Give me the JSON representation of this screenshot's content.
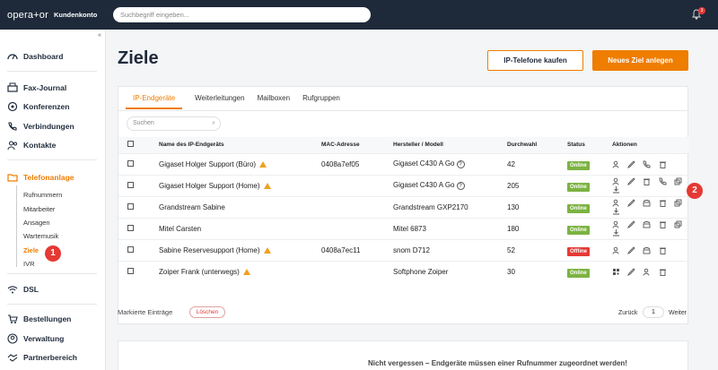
{
  "app": {
    "logo": "opera+or",
    "logo_sub": "Kundenkonto",
    "search_placeholder": "Suchbegriff eingeben...",
    "notification_count": "3"
  },
  "sidebar": {
    "items": [
      {
        "label": "Dashboard",
        "icon": "gauge-icon"
      },
      {
        "label": "Fax-Journal",
        "icon": "fax-icon"
      },
      {
        "label": "Konferenzen",
        "icon": "conference-icon"
      },
      {
        "label": "Verbindungen",
        "icon": "phone-icon"
      },
      {
        "label": "Kontakte",
        "icon": "contacts-icon"
      },
      {
        "label": "Telefonanlage",
        "icon": "folder-icon"
      },
      {
        "label": "DSL",
        "icon": "wifi-icon"
      },
      {
        "label": "Bestellungen",
        "icon": "cart-icon"
      },
      {
        "label": "Verwaltung",
        "icon": "user-circle-icon"
      },
      {
        "label": "Partnerbereich",
        "icon": "handshake-icon"
      }
    ],
    "sub_items": [
      "Rufnummern",
      "Mitarbeiter",
      "Ansagen",
      "Wartemusik",
      "Ziele",
      "IVR"
    ],
    "marker_1": "1"
  },
  "main": {
    "title": "Ziele",
    "btn_buy": "IP-Telefone kaufen",
    "btn_new": "Neues Ziel anlegen",
    "tabs": [
      "IP-Endgeräte",
      "Weiterleitungen",
      "Mailboxen",
      "Rufgruppen"
    ],
    "search_placeholder": "Suchen",
    "columns": [
      "Name des IP-Endgeräts",
      "MAC-Adresse",
      "Hersteller / Modell",
      "Durchwahl",
      "Status",
      "Aktionen"
    ],
    "rows": [
      {
        "name": "Gigaset Holger Support (Büro)",
        "mac": "0408a7ef05",
        "model": "Gigaset C430 A Go",
        "ext": "42",
        "status": "Online"
      },
      {
        "name": "Gigaset Holger Support (Home)",
        "mac": "",
        "model": "Gigaset C430 A Go",
        "ext": "205",
        "status": "Online"
      },
      {
        "name": "Grandstream Sabine",
        "mac": "",
        "model": "Grandstream GXP2170",
        "ext": "130",
        "status": "Online"
      },
      {
        "name": "Mitel Carsten",
        "mac": "",
        "model": "Mitel 6873",
        "ext": "180",
        "status": "Online"
      },
      {
        "name": "Sabine Reservesupport (Home)",
        "mac": "0408a7ec11",
        "model": "snom D712",
        "ext": "52",
        "status": "Offline"
      },
      {
        "name": "Zoiper Frank (unterwegs)",
        "mac": "",
        "model": "Softphone Zoiper",
        "ext": "30",
        "status": "Online"
      }
    ],
    "marker_2": "2",
    "bulk_label": "Markierte Einträge",
    "btn_delete": "Löschen",
    "pager_prev": "Zurück",
    "pager_page": "1",
    "pager_next": "Weiter",
    "note": "Nicht vergessen – Endgeräte müssen einer Rufnummer zugeordnet werden!"
  },
  "colors": {
    "accent": "#ef7d00",
    "sidebar_bg": "#1e2a3a",
    "online": "#7cb342",
    "offline": "#e53935"
  }
}
